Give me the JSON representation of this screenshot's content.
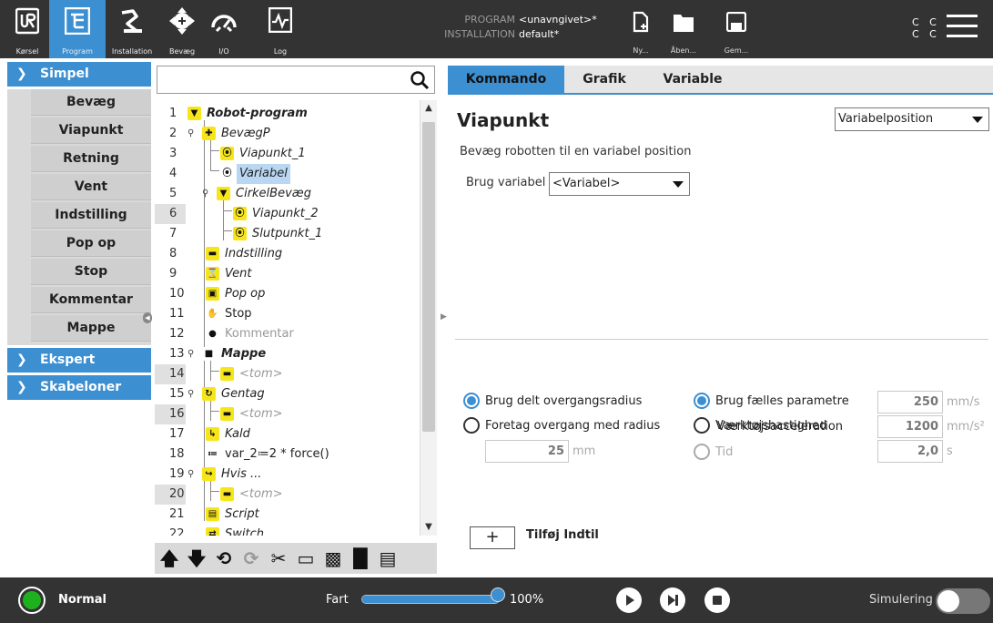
{
  "nav": {
    "items": [
      {
        "label": "Kørsel",
        "icon": "ur-logo-icon"
      },
      {
        "label": "Program",
        "icon": "program-tree-icon",
        "active": true
      },
      {
        "label": "Installation",
        "icon": "robot-arm-icon"
      },
      {
        "label": "Bevæg",
        "icon": "move-cross-icon"
      },
      {
        "label": "I/O",
        "icon": "io-gauge-icon"
      },
      {
        "label": "Log",
        "icon": "log-graph-icon"
      }
    ]
  },
  "program_info": {
    "program_key": "PROGRAM",
    "program_value": "<unavngivet>*",
    "installation_key": "INSTALLATION",
    "installation_value": "default*"
  },
  "file_buttons": {
    "new": "Ny...",
    "open": "Åben...",
    "save": "Gem..."
  },
  "cc_indicator": {
    "line1": "C C",
    "line2": "C C"
  },
  "categories": {
    "simple": {
      "label": "Simpel",
      "items": [
        "Bevæg",
        "Viapunkt",
        "Retning",
        "Vent",
        "Indstilling",
        "Pop op",
        "Stop",
        "Kommentar",
        "Mappe"
      ]
    },
    "expert": {
      "label": "Ekspert"
    },
    "templates": {
      "label": "Skabeloner"
    }
  },
  "tree": {
    "lines": [
      {
        "n": "1",
        "text": "Robot-program"
      },
      {
        "n": "2",
        "text": "BevægP"
      },
      {
        "n": "3",
        "text": "Viapunkt_1"
      },
      {
        "n": "4",
        "text": "Variabel"
      },
      {
        "n": "5",
        "text": "CirkelBevæg"
      },
      {
        "n": "6",
        "text": "Viapunkt_2"
      },
      {
        "n": "7",
        "text": "Slutpunkt_1"
      },
      {
        "n": "8",
        "text": "Indstilling"
      },
      {
        "n": "9",
        "text": "Vent"
      },
      {
        "n": "10",
        "text": "Pop op"
      },
      {
        "n": "11",
        "text": "Stop"
      },
      {
        "n": "12",
        "text": "Kommentar"
      },
      {
        "n": "13",
        "text": "Mappe"
      },
      {
        "n": "14",
        "text": "<tom>"
      },
      {
        "n": "15",
        "text": "Gentag"
      },
      {
        "n": "16",
        "text": "<tom>"
      },
      {
        "n": "17",
        "text": "Kald"
      },
      {
        "n": "18",
        "text": "var_2≔2 * force()"
      },
      {
        "n": "19",
        "text": "Hvis ..."
      },
      {
        "n": "20",
        "text": "<tom>"
      },
      {
        "n": "21",
        "text": "Script"
      },
      {
        "n": "22",
        "text": "Switch"
      }
    ],
    "selected_line": "4"
  },
  "tabs": [
    "Kommando",
    "Grafik",
    "Variable"
  ],
  "active_tab": "Kommando",
  "command": {
    "title": "Viapunkt",
    "waypoint_type": "Variabelposition",
    "description": "Bevæg robotten til en variabel position",
    "use_variable_label": "Brug variabel",
    "variable_value": "<Variabel>"
  },
  "blend": {
    "shared_radius_label": "Brug delt overgangsradius",
    "shared_radius_selected": true,
    "radius_label": "Foretag overgang med radius",
    "radius_value": "25",
    "radius_unit": "mm"
  },
  "params": {
    "common_label": "Brug fælles parametre",
    "common_selected": true,
    "tool_speed_label": "Værktøjshastighed",
    "tool_speed_value": "250",
    "tool_speed_unit": "mm/s",
    "tool_accel_label": "Værktøjsacceleration",
    "tool_accel_value": "1200",
    "tool_accel_unit": "mm/s²",
    "time_label": "Tid",
    "time_value": "2,0",
    "time_unit": "s"
  },
  "add_until": {
    "button": "+",
    "label": "Tilføj Indtil"
  },
  "footer": {
    "status": "Normal",
    "speed_label": "Fart",
    "speed_value": "100%",
    "speed_fraction": 1.0,
    "simulation_label": "Simulering",
    "simulation_on": false
  },
  "colors": {
    "accent": "#3c8fd1",
    "topbar": "#333333",
    "status_ok": "#1db21d",
    "highlight_icon": "#f7e51c"
  }
}
